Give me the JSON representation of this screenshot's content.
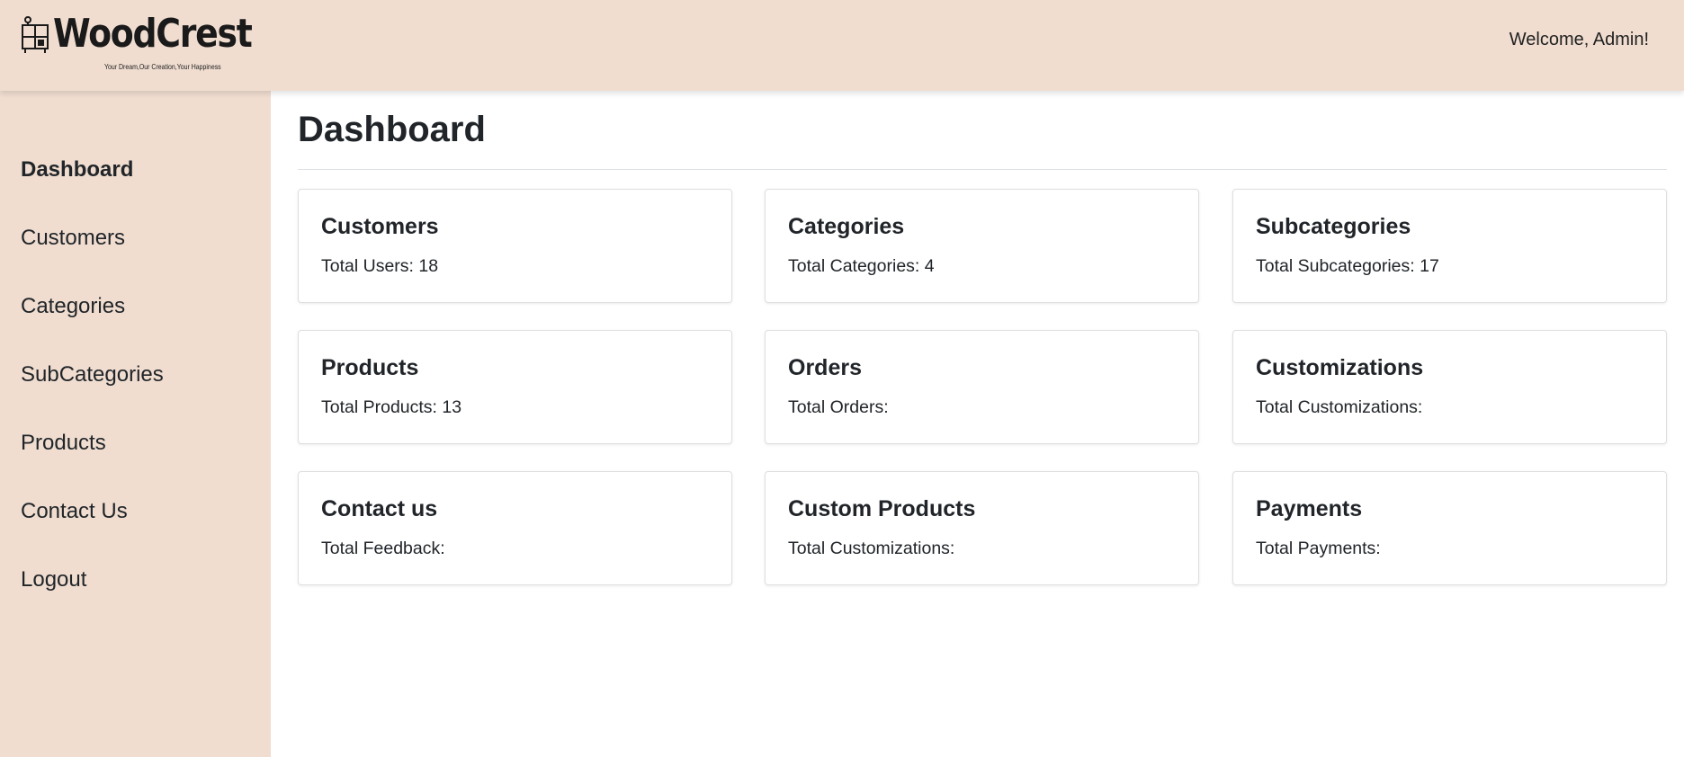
{
  "header": {
    "logo_text": "WoodCrest",
    "tagline": "Your Dream,Our Creation,Your Happiness",
    "logo_icon": "furniture-icon",
    "welcome": "Welcome, Admin!"
  },
  "sidebar": {
    "items": [
      {
        "label": "Dashboard",
        "active": true
      },
      {
        "label": "Customers"
      },
      {
        "label": "Categories"
      },
      {
        "label": "SubCategories"
      },
      {
        "label": "Products"
      },
      {
        "label": "Contact Us"
      },
      {
        "label": "Logout"
      }
    ]
  },
  "main": {
    "title": "Dashboard",
    "cards": [
      {
        "title": "Customers",
        "text": "Total Users: 18"
      },
      {
        "title": "Categories",
        "text": "Total Categories: 4"
      },
      {
        "title": "Subcategories",
        "text": "Total Subcategories: 17"
      },
      {
        "title": "Products",
        "text": "Total Products: 13"
      },
      {
        "title": "Orders",
        "text": "Total Orders:"
      },
      {
        "title": "Customizations",
        "text": "Total Customizations:"
      },
      {
        "title": "Contact us",
        "text": "Total Feedback:"
      },
      {
        "title": "Custom Products",
        "text": "Total Customizations:"
      },
      {
        "title": "Payments",
        "text": "Total Payments:"
      }
    ]
  },
  "colors": {
    "chrome_background": "#f0ddd0",
    "text": "#212529"
  }
}
